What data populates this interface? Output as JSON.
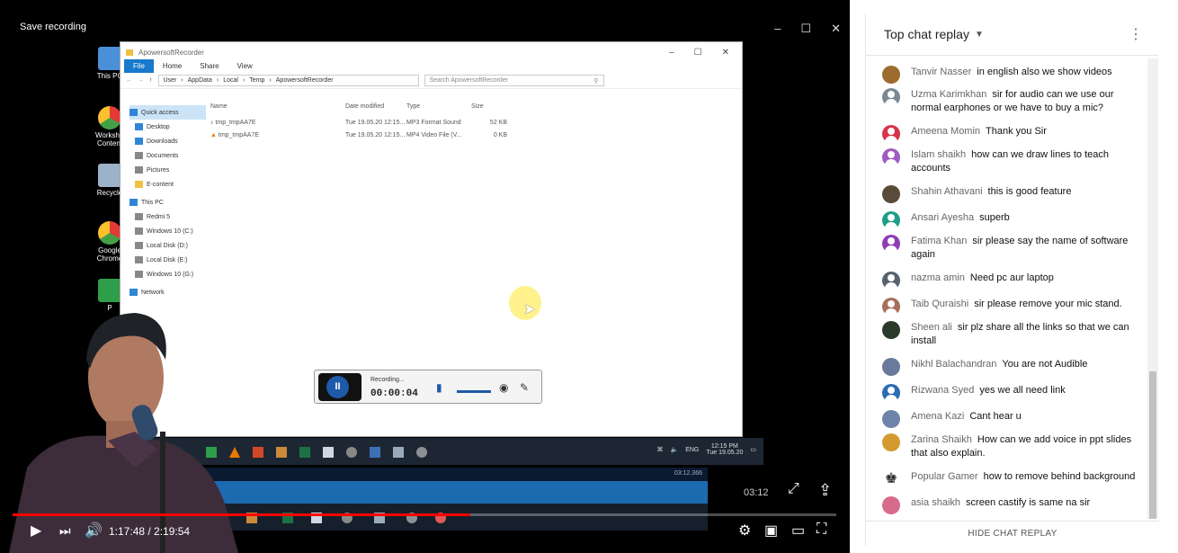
{
  "video": {
    "title": "Save recording",
    "window_controls": [
      "–",
      "☐",
      "✕"
    ],
    "desktop_icons": [
      "This PC",
      "Workshop Content",
      "Recycle",
      "Google Chrome",
      "P"
    ],
    "explorer": {
      "title": "ApowersoftRecorder",
      "ribbon": [
        "File",
        "Home",
        "Share",
        "View"
      ],
      "path": [
        "User",
        "AppData",
        "Local",
        "Temp",
        "ApowersoftRecorder"
      ],
      "search_placeholder": "Search ApowersoftRecorder",
      "nav": [
        "Quick access",
        "Desktop",
        "Downloads",
        "Documents",
        "Pictures",
        "E-content",
        "This PC",
        "Redmi 5",
        "Windows 10 (C:)",
        "Local Disk (D:)",
        "Local Disk (E:)",
        "Windows 10 (G:)",
        "Network"
      ],
      "columns": [
        "Name",
        "Date modified",
        "Type",
        "Size"
      ],
      "files": [
        {
          "name": "tmp_tmpAA7E",
          "date": "Tue 19.05.20 12:15...",
          "type": "MP3 Format Sound",
          "size": "52 KB"
        },
        {
          "name": "tmp_tmpAA7E",
          "date": "Tue 19.05.20 12:15...",
          "type": "MP4 Video File (V...",
          "size": "0 KB"
        }
      ]
    },
    "recorder": {
      "status": "Recording...",
      "time": "00:00:04",
      "button": "II"
    },
    "tray": {
      "lang": "ENG",
      "time": "12:15 PM",
      "date": "Tue 19.05.20"
    },
    "inner_time": "03:12.366",
    "side_time": "03:12",
    "player": {
      "timecode": "1:17:48 / 2:19:54",
      "progress": 0.556
    }
  },
  "chat": {
    "header": "Top chat replay",
    "footer": "HIDE CHAT REPLAY",
    "messages": [
      {
        "author": "Tanvir Nasser",
        "text": "in english also we show videos",
        "color": "#9c6b2e",
        "kind": "photo"
      },
      {
        "author": "Uzma Karimkhan",
        "text": "sir for audio can we use our normal earphones or we have to buy a mic?",
        "color": "#7a8a96",
        "kind": "default"
      },
      {
        "author": "Ameena Momin",
        "text": "Thank you Sir",
        "color": "#d8334a",
        "kind": "default"
      },
      {
        "author": "Islam shaikh",
        "text": "how can we draw lines to teach accounts",
        "color": "#9f5cc0",
        "kind": "default"
      },
      {
        "author": "Shahin Athavani",
        "text": "this is good feature",
        "color": "#5a4a3a",
        "kind": "photo"
      },
      {
        "author": "Ansari Ayesha",
        "text": "superb",
        "color": "#1e9e8a",
        "kind": "default"
      },
      {
        "author": "Fatima Khan",
        "text": "sir please say the name of software again",
        "color": "#8e3fb5",
        "kind": "default"
      },
      {
        "author": "nazma amin",
        "text": "Need pc aur laptop",
        "color": "#56626e",
        "kind": "default"
      },
      {
        "author": "Taib Quraishi",
        "text": "sir please remove your mic stand.",
        "color": "#a5705a",
        "kind": "default"
      },
      {
        "author": "Sheen ali",
        "text": "sir plz share all the links so that we can install",
        "color": "#2a3a2a",
        "kind": "photo"
      },
      {
        "author": "Nikhl Balachandran",
        "text": "You are not Audible",
        "color": "#6a7a9a",
        "kind": "photo"
      },
      {
        "author": "Rizwana Syed",
        "text": "yes we all need link",
        "color": "#2c6bb5",
        "kind": "default"
      },
      {
        "author": "Amena Kazi",
        "text": "Cant hear u",
        "color": "#6d84a8",
        "kind": "photo"
      },
      {
        "author": "Zarina Shaikh",
        "text": "How can we add voice in ppt slides that also explain.",
        "color": "#d49a30",
        "kind": "photo"
      },
      {
        "author": "Popular Gamer",
        "text": "how to remove behind background",
        "color": "#ffffff",
        "kind": "chess"
      },
      {
        "author": "asia shaikh",
        "text": "screen castify is same na sir",
        "color": "#d86a8a",
        "kind": "photo"
      }
    ]
  }
}
